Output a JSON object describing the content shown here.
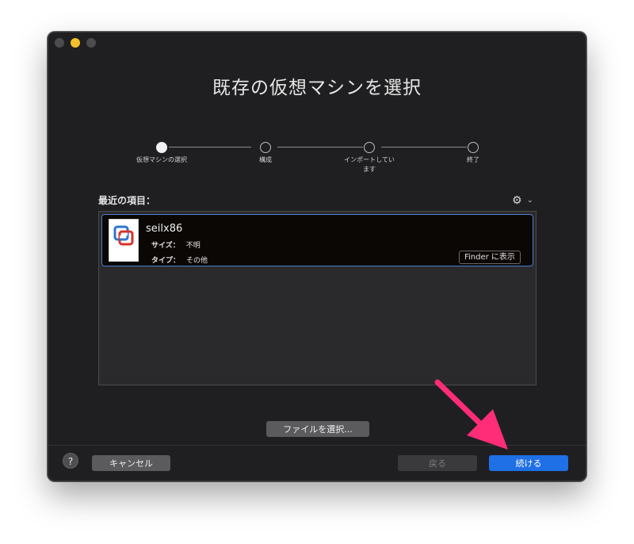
{
  "window": {
    "title": "既存の仮想マシンを選択"
  },
  "steps": [
    {
      "label": "仮想マシンの選択",
      "active": true
    },
    {
      "label": "構成",
      "active": false
    },
    {
      "label": "インポートしています",
      "active": false
    },
    {
      "label": "終了",
      "active": false
    }
  ],
  "recent": {
    "label": "最近の項目："
  },
  "vm": {
    "name": "seilx86",
    "size_key": "サイズ：",
    "size_value": "不明",
    "type_key": "タイプ：",
    "type_value": "その他",
    "finder_button": "Finder に表示"
  },
  "buttons": {
    "choose_file": "ファイルを選択...",
    "help": "?",
    "cancel": "キャンセル",
    "back": "戻る",
    "continue": "続ける"
  },
  "icons": {
    "gear": "gear-icon",
    "chevron": "chevron-down-icon",
    "vm": "vmware-icon",
    "annotation_arrow": "pink-arrow"
  },
  "colors": {
    "accent": "#1f6fe6",
    "annotation": "#ff2d78",
    "selection_border": "#4a7fcf"
  }
}
